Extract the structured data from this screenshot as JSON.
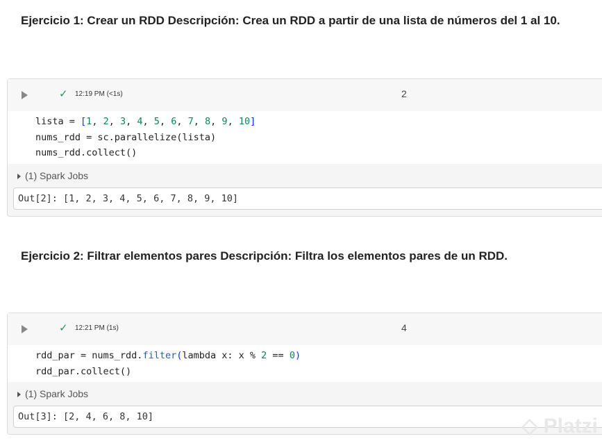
{
  "exercises": [
    {
      "heading": "Ejercicio 1: Crear un RDD Descripción: Crea un RDD a partir de una lista de números del 1 al 10.",
      "time": "12:19 PM (<1s)",
      "cell_number": "2",
      "spark_jobs": "(1) Spark Jobs",
      "output": "Out[2]: [1, 2, 3, 4, 5, 6, 7, 8, 9, 10]"
    },
    {
      "heading": "Ejercicio 2: Filtrar elementos pares Descripción: Filtra los elementos pares de un RDD.",
      "time": "12:21 PM (1s)",
      "cell_number": "4",
      "spark_jobs": "(1) Spark Jobs",
      "output": "Out[3]: [2, 4, 6, 8, 10]"
    }
  ],
  "code": {
    "c1_l1": "lista = [1, 2, 3, 4, 5, 6, 7, 8, 9, 10]",
    "c1_l2": "nums_rdd = sc.parallelize(lista)",
    "c1_l3": "nums_rdd.collect()",
    "c2_l1": "rdd_par = nums_rdd.filter(lambda x: x % 2 == 0)",
    "c2_l2": "rdd_par.collect()"
  },
  "watermark": "Platzi"
}
